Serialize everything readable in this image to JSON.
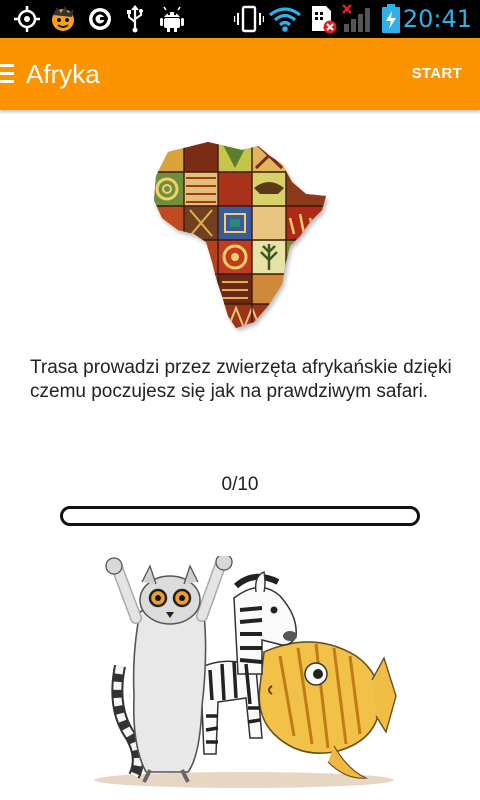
{
  "status_bar": {
    "time": "20:41",
    "icons": [
      "gps-icon",
      "app-mascot-icon",
      "cyanogen-icon",
      "usb-icon",
      "android-debug-icon",
      "vibrate-icon",
      "wifi-icon",
      "sim-error-icon",
      "signal-icon",
      "battery-charging-icon"
    ],
    "time_color": "#2fb0e8"
  },
  "app_bar": {
    "title": "Afryka",
    "action_label": "START",
    "color": "#fb9400"
  },
  "main": {
    "map_image": "africa-patchwork-map",
    "description": "Trasa prowadzi przez zwierzęta afrykańskie dzięki czemu poczujesz się jak na prawdziwym safari.",
    "progress": {
      "text": "0/10",
      "value": 0,
      "max": 10
    },
    "illustration": "lemur-zebra-fish-illustration"
  }
}
